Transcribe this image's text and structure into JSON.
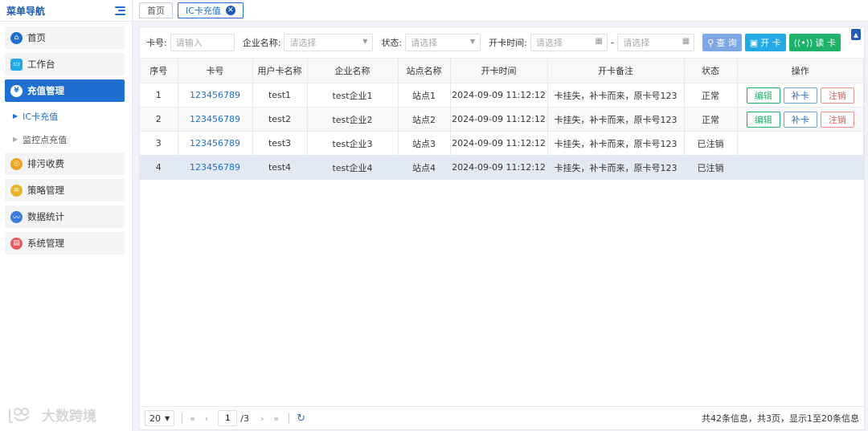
{
  "sidebar": {
    "title": "菜单导航",
    "items": [
      {
        "label": "首页",
        "icon": "home-icon",
        "color": "#1f6fd0"
      },
      {
        "label": "工作台",
        "icon": "monitor-icon",
        "color": "#23a9e6"
      },
      {
        "label": "充值管理",
        "icon": "money-bag-icon",
        "color": "#1f6fd0"
      },
      {
        "label": "排污收费",
        "icon": "coin-icon",
        "color": "#f0a020"
      },
      {
        "label": "策略管理",
        "icon": "layers-icon",
        "color": "#e6b422"
      },
      {
        "label": "数据统计",
        "icon": "chart-icon",
        "color": "#3a7bdc"
      },
      {
        "label": "系统管理",
        "icon": "settings-panel-icon",
        "color": "#e65a5a"
      }
    ],
    "subitems": [
      {
        "label": "IC卡充值"
      },
      {
        "label": "监控点充值"
      }
    ],
    "watermark": "大数跨境"
  },
  "tabs": [
    {
      "label": "首页"
    },
    {
      "label": "IC卡充值"
    }
  ],
  "filter": {
    "card_label": "卡号:",
    "card_placeholder": "请输入",
    "company_label": "企业名称:",
    "company_placeholder": "请选择",
    "status_label": "状态:",
    "status_placeholder": "请选择",
    "time_label": "开卡时间:",
    "start_placeholder": "请选择",
    "end_placeholder": "请选择",
    "dash": "-",
    "query_label": "查 询",
    "open_label": "开 卡",
    "read_label": "读 卡"
  },
  "table": {
    "headers": [
      "序号",
      "卡号",
      "用户卡名称",
      "企业名称",
      "站点名称",
      "开卡时间",
      "开卡备注",
      "状态",
      "操作"
    ],
    "rows": [
      {
        "no": "1",
        "card": "123456789",
        "name": "test1",
        "company": "test企业1",
        "site": "站点1",
        "time": "2024-09-09 11:12:12",
        "remark": "卡挂失，补卡而来，原卡号123",
        "status": "正常"
      },
      {
        "no": "2",
        "card": "123456789",
        "name": "test2",
        "company": "test企业2",
        "site": "站点2",
        "time": "2024-09-09 11:12:12",
        "remark": "卡挂失，补卡而来，原卡号123",
        "status": "正常"
      },
      {
        "no": "3",
        "card": "123456789",
        "name": "test3",
        "company": "test企业3",
        "site": "站点3",
        "time": "2024-09-09 11:12:12",
        "remark": "卡挂失，补卡而来，原卡号123",
        "status": "已注销"
      },
      {
        "no": "4",
        "card": "123456789",
        "name": "test4",
        "company": "test企业4",
        "site": "站点4",
        "time": "2024-09-09 11:12:12",
        "remark": "卡挂失，补卡而来，原卡号123",
        "status": "已注销"
      }
    ],
    "op_edit": "编辑",
    "op_reissue": "补卡",
    "op_cancel": "注销"
  },
  "pager": {
    "size": "20",
    "current": "1",
    "total_pages": "/3",
    "info": "共42条信息，共3页，显示1至20条信息"
  }
}
